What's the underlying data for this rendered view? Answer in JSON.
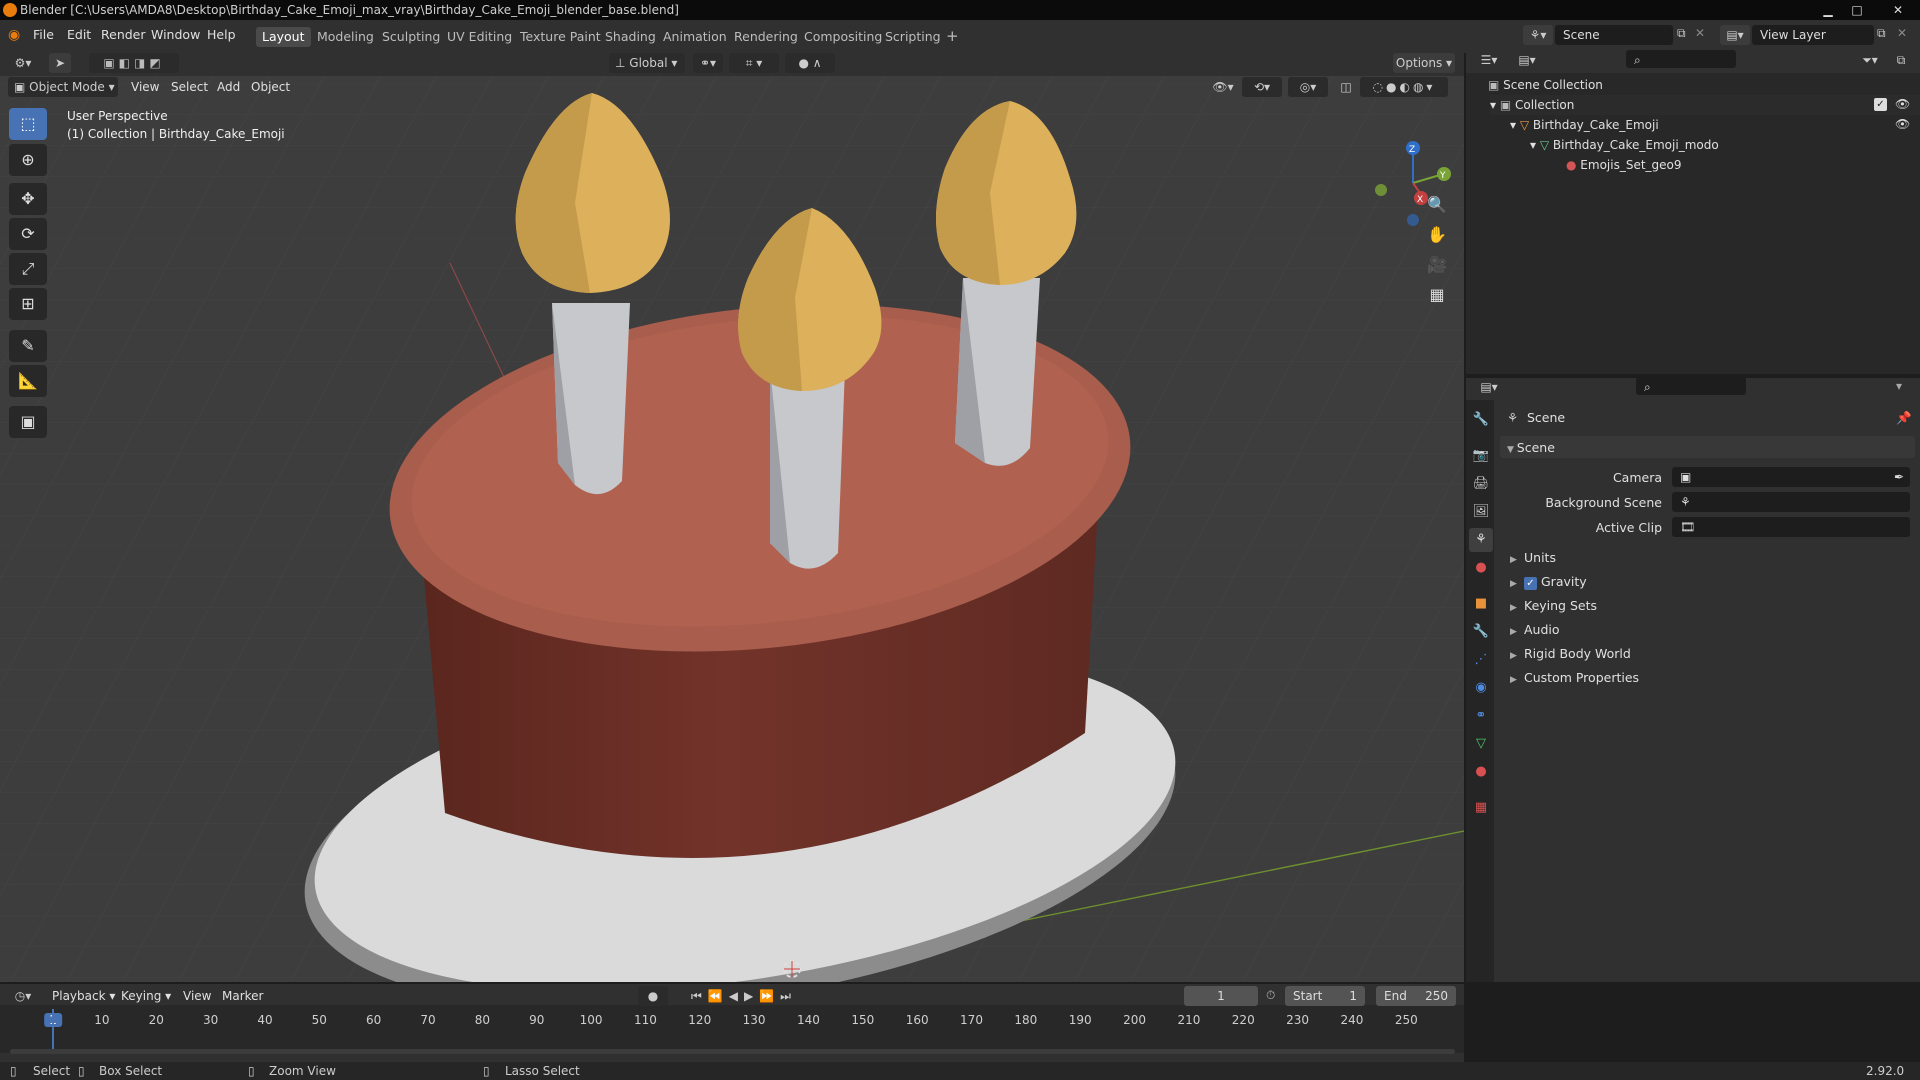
{
  "window": {
    "title": "Blender [C:\\Users\\AMDA8\\Desktop\\Birthday_Cake_Emoji_max_vray\\Birthday_Cake_Emoji_blender_base.blend]",
    "minimize": "▁",
    "maximize": "□",
    "close": "✕"
  },
  "menu": [
    "File",
    "Edit",
    "Render",
    "Window",
    "Help"
  ],
  "workspaces": [
    "Layout",
    "Modeling",
    "Sculpting",
    "UV Editing",
    "Texture Paint",
    "Shading",
    "Animation",
    "Rendering",
    "Compositing",
    "Scripting"
  ],
  "add_workspace": "+",
  "scene_field": "Scene",
  "view_layer_field": "View Layer",
  "header": {
    "orientation": "Global",
    "options": "Options",
    "mode": "Object Mode",
    "view": "View",
    "select": "Select",
    "add": "Add",
    "object": "Object"
  },
  "viewport": {
    "perspective": "User Perspective",
    "collection": "(1) Collection | Birthday_Cake_Emoji",
    "gizmo": {
      "x": "X",
      "y": "Y",
      "z": "Z"
    }
  },
  "colors": {
    "accent": "#4772b3",
    "cake_top": "#a95d4c",
    "cake_side": "#6f3227",
    "flame": "#ddb05c",
    "candle": "#c6c8cc",
    "plate": "#dcdcdc",
    "x_axis": "#c44040",
    "y_axis": "#7aa336"
  },
  "outliner": {
    "root": "Scene Collection",
    "collection": "Collection",
    "object": "Birthday_Cake_Emoji",
    "mesh": "Birthday_Cake_Emoji_modo",
    "material": "Emojis_Set_geo9"
  },
  "properties": {
    "header": "Scene",
    "panel": "Scene",
    "camera_label": "Camera",
    "background_label": "Background Scene",
    "clip_label": "Active Clip",
    "sections": [
      "Units",
      "Gravity",
      "Keying Sets",
      "Audio",
      "Rigid Body World",
      "Custom Properties"
    ],
    "gravity_checked": true
  },
  "timeline": {
    "playback": "Playback",
    "keying": "Keying",
    "view": "View",
    "marker": "Marker",
    "current_frame": "1",
    "start_label": "Start",
    "start": "1",
    "end_label": "End",
    "end": "250",
    "ticks": [
      "1",
      "10",
      "20",
      "30",
      "40",
      "50",
      "60",
      "70",
      "80",
      "90",
      "100",
      "110",
      "120",
      "130",
      "140",
      "150",
      "160",
      "170",
      "180",
      "190",
      "200",
      "210",
      "220",
      "230",
      "240",
      "250"
    ]
  },
  "status": {
    "select": "Select",
    "box_select": "Box Select",
    "zoom_view": "Zoom View",
    "lasso_select": "Lasso Select",
    "version": "2.92.0"
  }
}
